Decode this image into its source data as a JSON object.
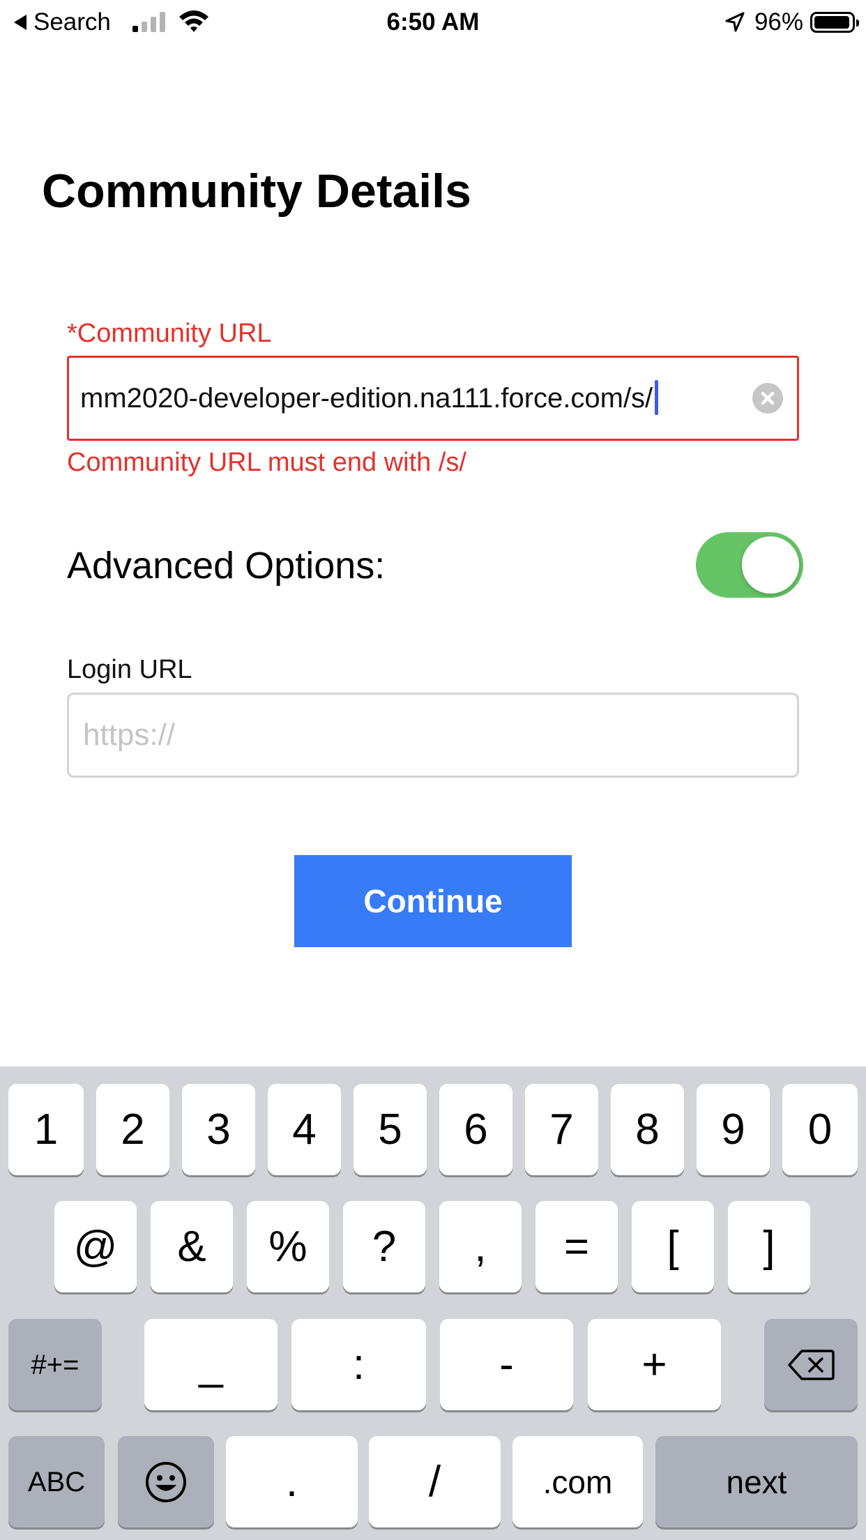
{
  "status_bar": {
    "back_label": "Search",
    "time": "6:50 AM",
    "battery": "96%",
    "battery_level": 0.96
  },
  "page": {
    "title": "Community Details"
  },
  "community_url": {
    "label": "*Community URL",
    "value": "mm2020-developer-edition.na111.force.com/s/",
    "error": "Community URL must end with /s/"
  },
  "advanced": {
    "label": "Advanced Options:",
    "enabled": true
  },
  "login_url": {
    "label": "Login URL",
    "placeholder": "https://"
  },
  "continue_label": "Continue",
  "colors": {
    "error": "#e3322c",
    "accent": "#377cf6",
    "toggle_on": "#65c466"
  },
  "keyboard": {
    "row1": [
      "1",
      "2",
      "3",
      "4",
      "5",
      "6",
      "7",
      "8",
      "9",
      "0"
    ],
    "row2": [
      "@",
      "&",
      "%",
      "?",
      ",",
      "=",
      "[",
      "]"
    ],
    "row3": [
      "#+=",
      "_",
      ":",
      "-",
      "+",
      "backspace"
    ],
    "row4": [
      "ABC",
      "emoji",
      ".",
      "/",
      ".com",
      "next"
    ]
  }
}
